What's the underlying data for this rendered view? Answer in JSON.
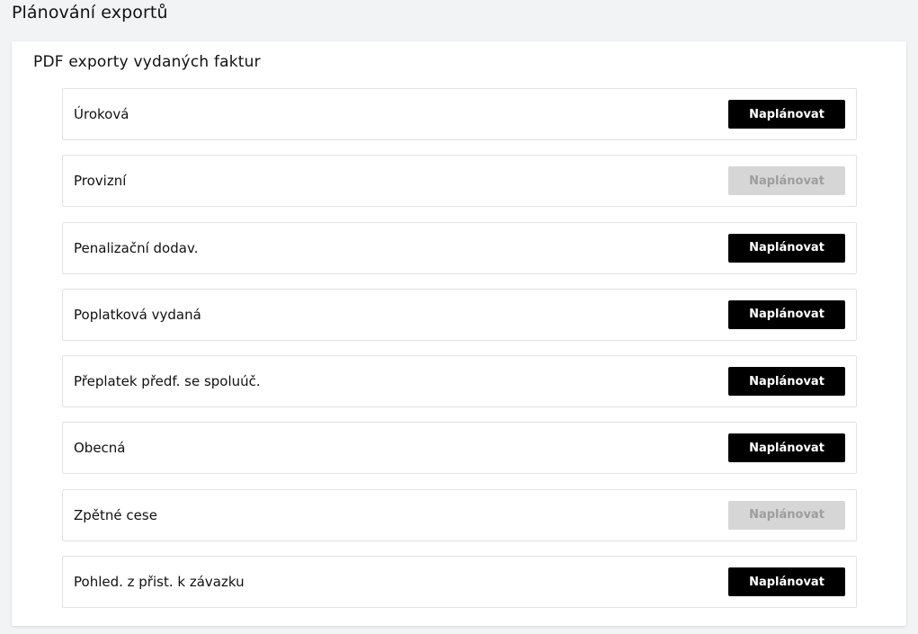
{
  "page": {
    "title": "Plánování exportů"
  },
  "section": {
    "title": "PDF exporty vydaných faktur",
    "rows": [
      {
        "label": "Úroková",
        "button": "Naplánovat",
        "enabled": true
      },
      {
        "label": "Provizní",
        "button": "Naplánovat",
        "enabled": false
      },
      {
        "label": "Penalizační dodav.",
        "button": "Naplánovat",
        "enabled": true
      },
      {
        "label": "Poplatková vydaná",
        "button": "Naplánovat",
        "enabled": true
      },
      {
        "label": "Přeplatek předf. se spoluúč.",
        "button": "Naplánovat",
        "enabled": true
      },
      {
        "label": "Obecná",
        "button": "Naplánovat",
        "enabled": true
      },
      {
        "label": "Zpětné cese",
        "button": "Naplánovat",
        "enabled": false
      },
      {
        "label": "Pohled. z přist. k závazku",
        "button": "Naplánovat",
        "enabled": true
      }
    ]
  },
  "colors": {
    "button_enabled_bg": "#000000",
    "button_enabled_text": "#ffffff",
    "button_disabled_bg": "#d6d6d6",
    "button_disabled_text": "#9d9d9d"
  }
}
